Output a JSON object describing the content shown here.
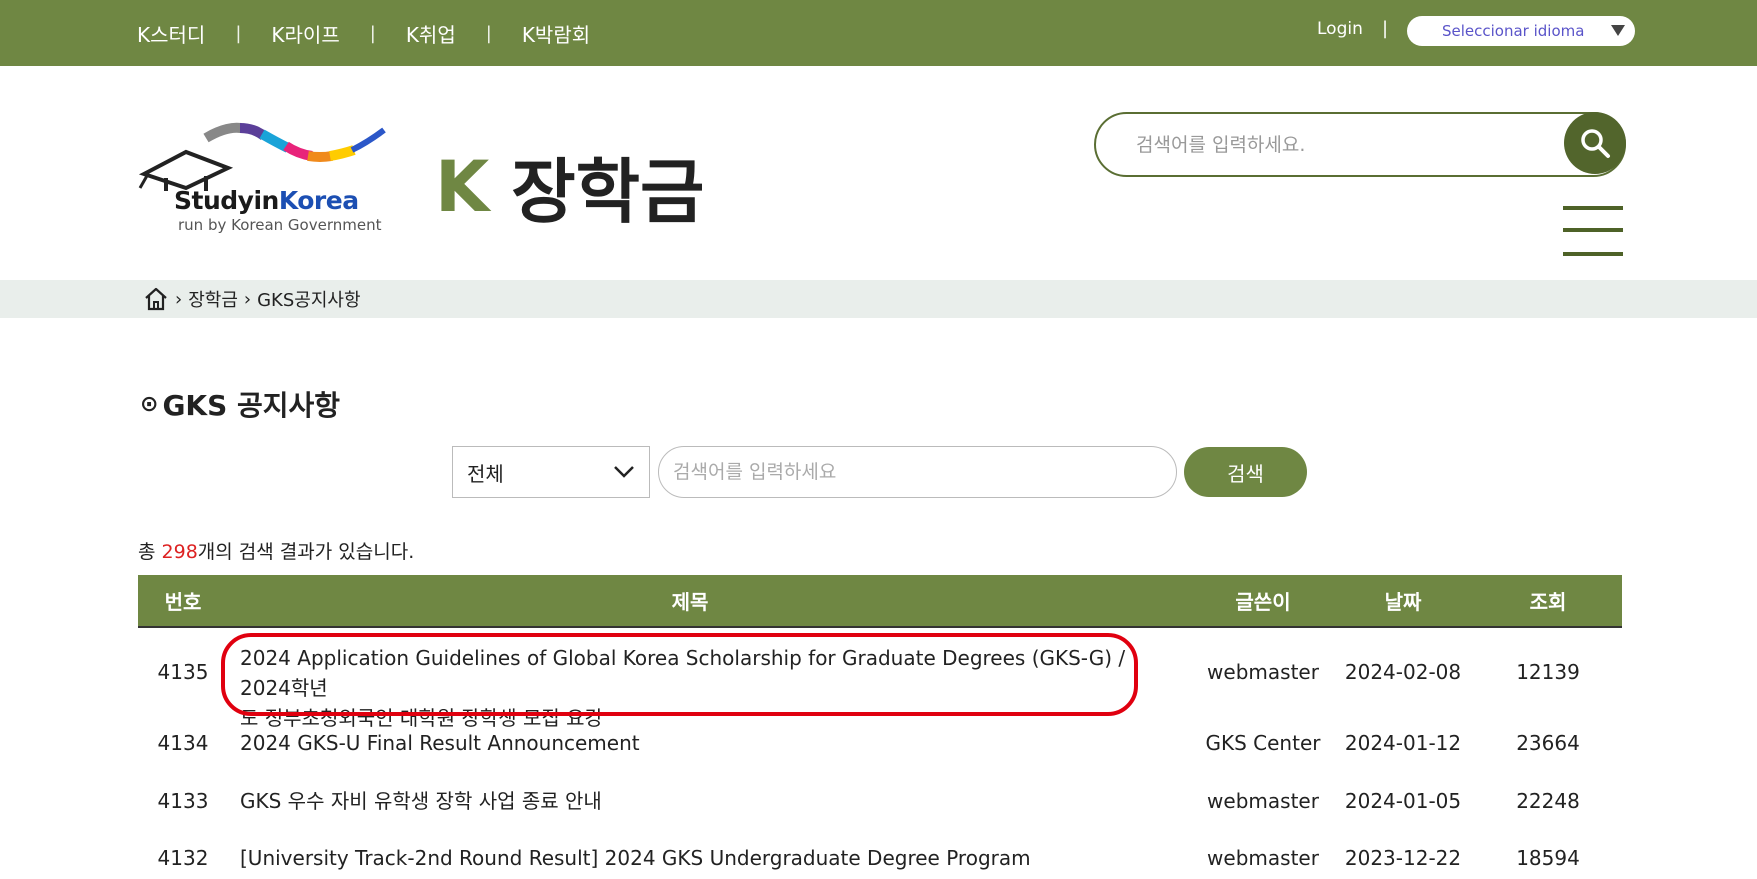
{
  "topnav": {
    "items": [
      "K스터디",
      "K라이프",
      "K취업",
      "K박람회"
    ],
    "separator": "|",
    "login": "Login",
    "language": "Seleccionar idioma"
  },
  "logo": {
    "name_part1": "Studyin",
    "name_part2": "Korea",
    "tagline": "run by Korean Government"
  },
  "brand": {
    "letter": "K",
    "title": "장학금"
  },
  "header_search": {
    "placeholder": "검색어를 입력하세요."
  },
  "breadcrumb": {
    "items": [
      "장학금",
      "GKS공지사항"
    ],
    "separator": "›"
  },
  "section": {
    "marker": "⊙",
    "title": "GKS 공지사항"
  },
  "filter": {
    "selected": "전체",
    "placeholder": "검색어를 입력하세요",
    "button": "검색"
  },
  "result": {
    "prefix": "총 ",
    "count": "298",
    "suffix": "개의 검색 결과가 있습니다."
  },
  "table": {
    "columns": [
      "번호",
      "제목",
      "글쓴이",
      "날짜",
      "조회"
    ],
    "rows": [
      {
        "num": "4135",
        "title_line1": "2024 Application Guidelines of Global Korea Scholarship for Graduate Degrees (GKS-G) / 2024학년",
        "title_line2": "도 정부초청외국인 대학원 장학생 모집 요강",
        "writer": "webmaster",
        "date": "2024-02-08",
        "views": "12139"
      },
      {
        "num": "4134",
        "title": "2024 GKS-U Final Result Announcement",
        "writer": "GKS Center",
        "date": "2024-01-12",
        "views": "23664"
      },
      {
        "num": "4133",
        "title": "GKS 우수 자비 유학생 장학 사업 종료 안내",
        "writer": "webmaster",
        "date": "2024-01-05",
        "views": "22248"
      },
      {
        "num": "4132",
        "title": "[University Track-2nd Round Result] 2024 GKS Undergraduate Degree Program",
        "writer": "webmaster",
        "date": "2023-12-22",
        "views": "18594"
      }
    ]
  },
  "colors": {
    "brand_green": "#6f8743",
    "dark_green": "#52652c",
    "highlight": "#e0000f"
  }
}
